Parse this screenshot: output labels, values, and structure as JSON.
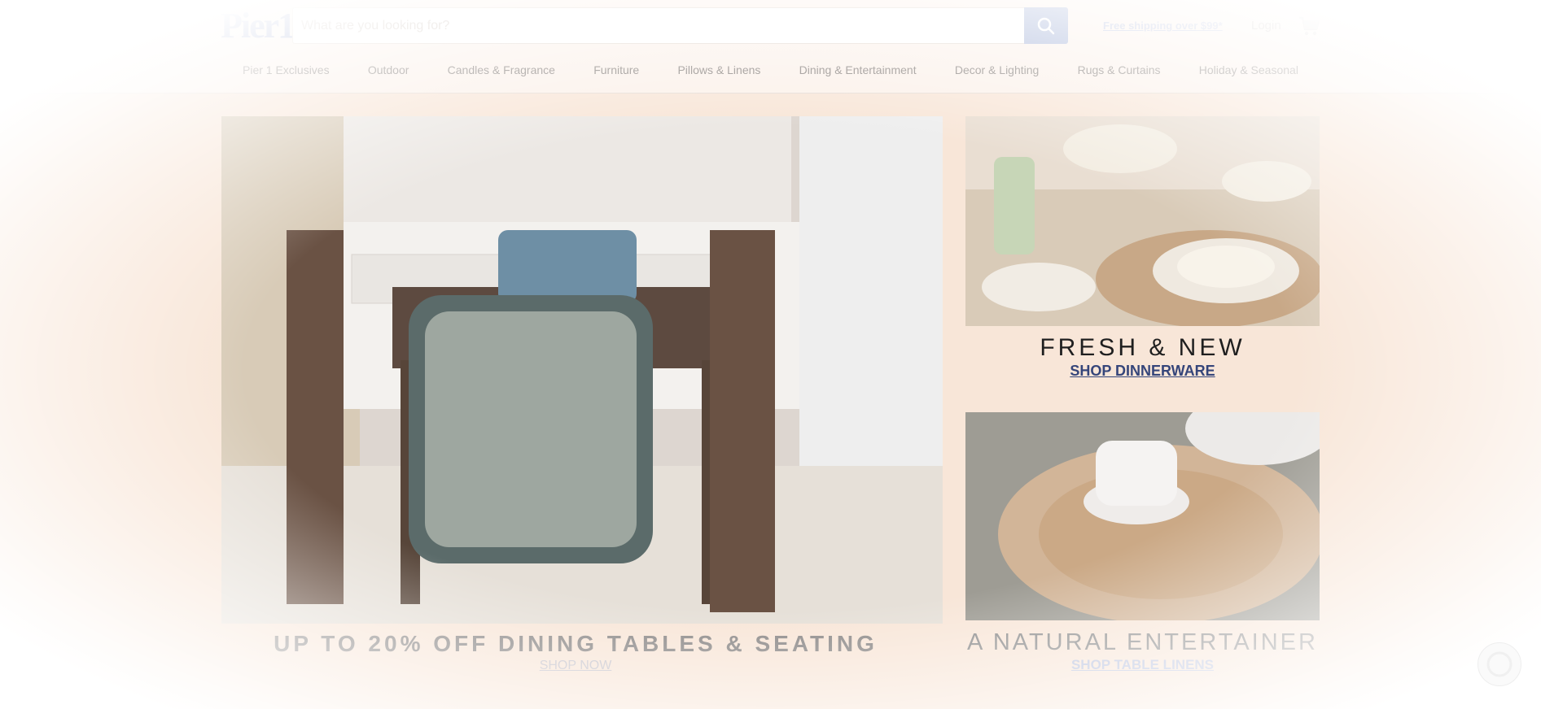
{
  "header": {
    "logo_text": "Pier1",
    "search": {
      "placeholder": "What are you looking for?",
      "value": ""
    },
    "free_shipping": "Free shipping over $99*",
    "login": "Login"
  },
  "nav": {
    "items": [
      "Pier 1 Exclusives",
      "Outdoor",
      "Candles & Fragrance",
      "Furniture",
      "Pillows & Linens",
      "Dining & Entertainment",
      "Decor & Lighting",
      "Rugs & Curtains",
      "Holiday & Seasonal"
    ]
  },
  "hero": {
    "title": "UP TO 20% OFF DINING TABLES & SEATING",
    "link": "SHOP NOW"
  },
  "promo1": {
    "title": "FRESH & NEW",
    "link": "SHOP DINNERWARE"
  },
  "promo2": {
    "title": "A NATURAL ENTERTAINER",
    "link": "SHOP TABLE LINENS"
  },
  "icons": {
    "search": "search-icon",
    "cart": "cart-icon",
    "chat": "chat-icon"
  }
}
